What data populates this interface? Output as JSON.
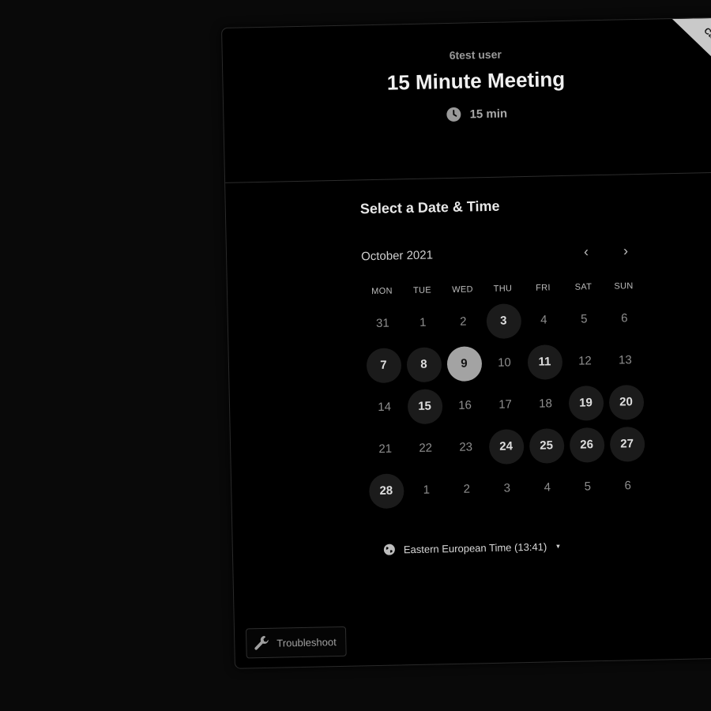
{
  "ribbon": {
    "text": "Ca"
  },
  "header": {
    "host_name": "6test user",
    "event_title": "15 Minute Meeting",
    "duration": "15 min",
    "duration_icon": "clock-icon"
  },
  "calendar": {
    "section_title": "Select a Date & Time",
    "month_label": "October 2021",
    "prev_icon": "‹",
    "next_icon": "›",
    "weekdays": [
      "MON",
      "TUE",
      "WED",
      "THU",
      "FRI",
      "SAT",
      "SUN"
    ],
    "weeks": [
      [
        {
          "d": "31",
          "s": "muted"
        },
        {
          "d": "1",
          "s": "muted"
        },
        {
          "d": "2",
          "s": "muted"
        },
        {
          "d": "3",
          "s": "available"
        },
        {
          "d": "4",
          "s": "muted"
        },
        {
          "d": "5",
          "s": "muted"
        },
        {
          "d": "6",
          "s": "muted"
        }
      ],
      [
        {
          "d": "7",
          "s": "available"
        },
        {
          "d": "8",
          "s": "available"
        },
        {
          "d": "9",
          "s": "selected"
        },
        {
          "d": "10",
          "s": "muted"
        },
        {
          "d": "11",
          "s": "available"
        },
        {
          "d": "12",
          "s": "muted"
        },
        {
          "d": "13",
          "s": "muted"
        }
      ],
      [
        {
          "d": "14",
          "s": "muted"
        },
        {
          "d": "15",
          "s": "available"
        },
        {
          "d": "16",
          "s": "muted"
        },
        {
          "d": "17",
          "s": "muted"
        },
        {
          "d": "18",
          "s": "muted"
        },
        {
          "d": "19",
          "s": "available"
        },
        {
          "d": "20",
          "s": "available"
        }
      ],
      [
        {
          "d": "21",
          "s": "muted"
        },
        {
          "d": "22",
          "s": "muted"
        },
        {
          "d": "23",
          "s": "muted"
        },
        {
          "d": "24",
          "s": "available"
        },
        {
          "d": "25",
          "s": "available"
        },
        {
          "d": "26",
          "s": "available"
        },
        {
          "d": "27",
          "s": "available"
        }
      ],
      [
        {
          "d": "28",
          "s": "available"
        },
        {
          "d": "1",
          "s": "muted"
        },
        {
          "d": "2",
          "s": "muted"
        },
        {
          "d": "3",
          "s": "muted"
        },
        {
          "d": "4",
          "s": "muted"
        },
        {
          "d": "5",
          "s": "muted"
        },
        {
          "d": "6",
          "s": "muted"
        }
      ]
    ]
  },
  "timezone": {
    "label": "Eastern European Time (13:41)",
    "icon": "globe-icon",
    "caret": "▾"
  },
  "troubleshoot": {
    "label": "Troubleshoot",
    "icon": "wrench-icon"
  },
  "colors": {
    "background": "#090909",
    "card": "#000000",
    "available_day": "#1b1b1b",
    "selected_day": "#a3a3a3",
    "ribbon": "#c9c9c9"
  }
}
